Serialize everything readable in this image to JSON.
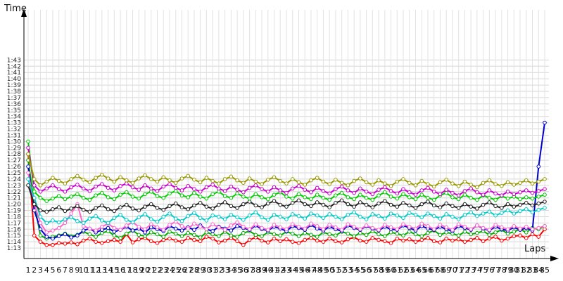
{
  "chart_data": {
    "type": "line",
    "title": "",
    "xlabel": "Laps",
    "ylabel": "Time",
    "x_ticks": [
      "1",
      "2",
      "3",
      "4",
      "5",
      "6",
      "7",
      "8",
      "9",
      "10",
      "11",
      "12",
      "13",
      "14",
      "15",
      "16",
      "17",
      "18",
      "19",
      "20",
      "21",
      "22",
      "23",
      "24",
      "25",
      "26",
      "27",
      "28",
      "29",
      "30",
      "31",
      "32",
      "33",
      "34",
      "35",
      "36",
      "37",
      "38",
      "39",
      "40",
      "41",
      "42",
      "43",
      "44",
      "45",
      "46",
      "47",
      "48",
      "49",
      "50",
      "51",
      "52",
      "53",
      "54",
      "55",
      "56",
      "57",
      "58",
      "59",
      "60",
      "61",
      "62",
      "63",
      "64",
      "65",
      "66",
      "67",
      "68",
      "69",
      "70",
      "71",
      "72",
      "73",
      "74",
      "75",
      "76",
      "77",
      "78",
      "79",
      "80",
      "81",
      "82",
      "83",
      "84",
      "85"
    ],
    "y_ticks": [
      "1:13",
      "1:14",
      "1:15",
      "1:16",
      "1:17",
      "1:18",
      "1:19",
      "1:20",
      "1:21",
      "1:22",
      "1:23",
      "1:24",
      "1:25",
      "1:26",
      "1:27",
      "1:28",
      "1:29",
      "1:30",
      "1:31",
      "1:32",
      "1:33",
      "1:34",
      "1:35",
      "1:36",
      "1:37",
      "1:38",
      "1:39",
      "1:40",
      "1:41",
      "1:42",
      "1:43"
    ],
    "y_unit": "lap time in seconds (73 = 1:13)",
    "xlim": [
      1,
      85
    ],
    "ylim": [
      72,
      111
    ],
    "grid": true,
    "legend": "none",
    "series": [
      {
        "color": "#ff0000",
        "values": [
          88,
          75,
          74,
          73.5,
          73.5,
          73.8,
          73.7,
          73.9,
          73.6,
          74.2,
          74.5,
          74.0,
          73.8,
          74.1,
          74.3,
          74.0,
          75.2,
          73.9,
          74.4,
          74.6,
          74.1,
          73.8,
          74.3,
          74.5,
          74.2,
          74.0,
          74.6,
          74.3,
          74.1,
          74.8,
          74.5,
          73.9,
          74.2,
          74.6,
          74.1,
          73.5,
          74.3,
          74.7,
          74.2,
          73.9,
          74.5,
          74.1,
          74.4,
          74.0,
          73.8,
          74.3,
          74.6,
          74.2,
          74.0,
          74.5,
          74.1,
          73.9,
          74.4,
          74.7,
          74.2,
          74.0,
          74.6,
          74.3,
          74.1,
          73.8,
          74.5,
          74.2,
          74.4,
          74.0,
          74.3,
          74.6,
          74.1,
          73.9,
          74.5,
          74.2,
          74.4,
          74.0,
          74.3,
          74.6,
          74.1,
          74.5,
          74.8,
          74.2,
          74.5,
          74.9,
          75.0,
          74.6,
          75.2,
          74.8,
          76.0
        ]
      },
      {
        "color": "#00aa00",
        "values": [
          87,
          80,
          75,
          74.5,
          74.8,
          75.0,
          75.3,
          74.9,
          75.1,
          75.6,
          75.2,
          74.8,
          75.4,
          75.7,
          75.0,
          74.6,
          75.3,
          75.8,
          75.1,
          74.9,
          75.5,
          75.2,
          74.8,
          75.6,
          75.3,
          74.9,
          75.4,
          75.1,
          74.7,
          75.5,
          75.2,
          74.9,
          75.6,
          75.0,
          74.8,
          75.4,
          75.7,
          75.1,
          74.9,
          75.5,
          75.2,
          75.0,
          75.6,
          75.3,
          74.9,
          75.4,
          75.1,
          74.8,
          75.5,
          75.2,
          75.0,
          75.6,
          75.3,
          74.9,
          75.4,
          75.1,
          75.7,
          75.2,
          74.9,
          75.5,
          75.3,
          75.0,
          75.6,
          75.2,
          74.9,
          75.4,
          75.8,
          75.1,
          75.5,
          75.3,
          75.0,
          75.6,
          75.2,
          75.4,
          75.7,
          75.1,
          75.5,
          75.9,
          75.3,
          75.6,
          76.0,
          75.5,
          76.2,
          76.0,
          76.5
        ]
      },
      {
        "color": "#0000cc",
        "values": [
          86,
          79,
          76,
          74.8,
          74.5,
          74.9,
          75.2,
          74.7,
          75.0,
          75.8,
          76.1,
          75.5,
          75.9,
          76.2,
          75.6,
          75.9,
          76.4,
          75.8,
          76.1,
          75.5,
          76.3,
          76.0,
          75.7,
          76.5,
          76.1,
          75.8,
          76.3,
          75.9,
          76.6,
          76.0,
          75.7,
          76.4,
          76.1,
          75.8,
          76.5,
          76.2,
          75.9,
          76.6,
          76.0,
          75.8,
          76.4,
          76.1,
          75.7,
          76.5,
          76.2,
          75.9,
          76.7,
          76.1,
          75.8,
          76.4,
          76.0,
          75.7,
          76.6,
          76.2,
          75.9,
          76.5,
          76.1,
          75.8,
          76.4,
          76.0,
          75.9,
          76.6,
          76.2,
          75.8,
          76.5,
          76.1,
          75.9,
          76.4,
          76.0,
          75.7,
          76.5,
          76.2,
          75.9,
          76.6,
          76.1,
          75.8,
          76.4,
          76.0,
          75.8,
          76.3,
          75.9,
          76.2,
          75.8,
          86.0,
          93.0
        ]
      },
      {
        "color": "#ff66cc",
        "values": [
          85,
          80,
          77,
          75.5,
          75.8,
          76.2,
          77.0,
          78.5,
          80.0,
          76.5,
          76.1,
          75.8,
          76.4,
          76.9,
          76.2,
          75.9,
          76.6,
          77.1,
          76.4,
          76.0,
          76.8,
          76.3,
          75.9,
          76.7,
          77.2,
          76.5,
          76.1,
          76.9,
          76.4,
          76.0,
          76.8,
          76.3,
          75.9,
          76.6,
          77.1,
          76.4,
          76.0,
          76.8,
          76.2,
          75.9,
          76.7,
          76.3,
          76.0,
          76.8,
          76.4,
          76.1,
          76.9,
          76.5,
          76.0,
          76.7,
          76.3,
          75.9,
          76.8,
          76.4,
          76.0,
          76.6,
          76.2,
          75.9,
          76.7,
          76.3,
          76.0,
          76.8,
          76.4,
          76.1,
          76.9,
          76.5,
          76.0,
          76.7,
          76.3,
          75.9,
          76.8,
          76.4,
          76.0,
          76.6,
          76.2,
          75.9,
          76.7,
          76.3,
          76.0,
          76.5,
          76.1,
          76.4,
          76.0,
          76.2,
          76.5
        ]
      },
      {
        "color": "#00cccc",
        "values": [
          84,
          81,
          78,
          77.0,
          77.4,
          77.1,
          77.6,
          77.9,
          77.3,
          77.0,
          77.7,
          78.1,
          77.4,
          77.0,
          77.8,
          78.3,
          77.5,
          77.1,
          77.9,
          78.4,
          77.6,
          77.2,
          78.0,
          78.5,
          77.7,
          77.3,
          78.1,
          78.6,
          77.8,
          77.4,
          78.2,
          78.0,
          77.6,
          78.3,
          77.9,
          77.5,
          78.2,
          78.7,
          77.9,
          77.5,
          78.3,
          78.0,
          77.6,
          78.4,
          78.1,
          77.7,
          78.5,
          78.2,
          77.8,
          78.4,
          78.0,
          77.6,
          78.3,
          78.7,
          78.0,
          77.6,
          78.4,
          78.1,
          77.7,
          78.5,
          78.2,
          77.8,
          78.6,
          78.3,
          77.9,
          78.5,
          78.1,
          77.7,
          78.4,
          78.0,
          77.6,
          78.3,
          78.7,
          78.1,
          78.5,
          78.8,
          78.2,
          78.6,
          79.0,
          78.5,
          78.9,
          79.2,
          78.7,
          79.1,
          79.4
        ]
      },
      {
        "color": "#222222",
        "values": [
          83,
          80,
          79,
          78.8,
          79.2,
          79.5,
          78.9,
          79.3,
          79.7,
          79.1,
          78.8,
          79.4,
          79.8,
          79.2,
          78.9,
          79.5,
          79.9,
          79.3,
          79.0,
          79.6,
          80.0,
          79.4,
          79.1,
          79.7,
          80.1,
          79.5,
          79.2,
          79.8,
          80.2,
          79.6,
          79.3,
          79.9,
          80.3,
          79.7,
          79.4,
          80.0,
          80.4,
          79.8,
          79.5,
          80.1,
          80.5,
          79.9,
          79.6,
          80.2,
          80.6,
          80.0,
          79.7,
          80.3,
          79.9,
          79.5,
          80.2,
          80.6,
          80.0,
          79.6,
          80.3,
          79.9,
          79.5,
          80.1,
          80.5,
          79.9,
          79.6,
          80.2,
          79.8,
          79.4,
          80.0,
          80.4,
          79.8,
          79.5,
          80.1,
          79.7,
          79.4,
          80.0,
          79.6,
          79.3,
          79.9,
          80.3,
          79.7,
          79.4,
          80.0,
          79.6,
          79.9,
          80.2,
          79.8,
          80.1,
          80.4
        ]
      },
      {
        "color": "#00cc00",
        "values": [
          90,
          82,
          81,
          80.5,
          80.9,
          81.3,
          80.8,
          81.2,
          81.6,
          81.0,
          80.7,
          81.4,
          81.8,
          81.1,
          80.8,
          81.5,
          81.9,
          81.2,
          80.9,
          81.6,
          82.0,
          81.3,
          81.0,
          81.7,
          82.1,
          81.4,
          81.1,
          81.8,
          81.2,
          80.9,
          81.6,
          82.0,
          81.3,
          81.0,
          81.7,
          81.2,
          80.9,
          81.6,
          81.1,
          80.8,
          81.5,
          81.9,
          81.2,
          80.9,
          81.6,
          81.1,
          80.8,
          81.5,
          81.0,
          80.7,
          81.4,
          81.8,
          81.1,
          80.8,
          81.5,
          81.0,
          80.7,
          81.4,
          81.9,
          81.2,
          80.9,
          81.6,
          81.1,
          80.8,
          81.5,
          81.0,
          80.7,
          81.4,
          81.8,
          81.1,
          80.8,
          81.5,
          81.0,
          80.7,
          81.4,
          81.0,
          80.7,
          81.3,
          80.9,
          81.2,
          80.8,
          81.1,
          80.9,
          81.2,
          81.5
        ]
      },
      {
        "color": "#cc00cc",
        "values": [
          89,
          83,
          82,
          82.5,
          83.0,
          82.4,
          82.0,
          82.7,
          83.1,
          82.5,
          82.1,
          82.8,
          83.2,
          82.6,
          82.2,
          82.9,
          83.3,
          82.7,
          82.3,
          83.0,
          82.5,
          82.1,
          82.8,
          83.2,
          82.6,
          82.2,
          82.9,
          82.4,
          82.0,
          82.7,
          83.1,
          82.5,
          82.1,
          82.8,
          82.3,
          81.9,
          82.6,
          83.0,
          82.4,
          82.0,
          82.7,
          82.2,
          81.8,
          82.5,
          82.9,
          82.3,
          81.9,
          82.6,
          82.1,
          81.7,
          82.4,
          82.8,
          82.2,
          81.8,
          82.5,
          82.0,
          81.6,
          82.3,
          82.7,
          82.1,
          81.7,
          82.4,
          81.9,
          81.5,
          82.2,
          82.6,
          82.0,
          81.6,
          82.3,
          81.8,
          81.4,
          82.1,
          82.5,
          81.9,
          81.5,
          82.2,
          81.7,
          81.4,
          82.0,
          81.6,
          81.9,
          82.2,
          81.8,
          82.1,
          82.4
        ]
      },
      {
        "color": "#999900",
        "values": [
          88,
          84,
          83,
          83.6,
          84.2,
          83.7,
          83.3,
          84.0,
          84.5,
          83.9,
          83.5,
          84.2,
          84.7,
          84.1,
          83.6,
          84.3,
          83.8,
          83.4,
          84.1,
          84.6,
          84.0,
          83.6,
          84.3,
          83.8,
          83.4,
          84.1,
          84.5,
          83.9,
          83.5,
          84.2,
          83.7,
          83.3,
          84.0,
          84.4,
          83.8,
          83.4,
          84.1,
          83.6,
          83.2,
          83.9,
          84.3,
          83.7,
          83.3,
          84.0,
          83.5,
          83.1,
          83.8,
          84.2,
          83.6,
          83.2,
          83.9,
          83.4,
          83.0,
          83.7,
          84.1,
          83.5,
          83.1,
          83.8,
          83.3,
          82.9,
          83.6,
          84.0,
          83.4,
          83.0,
          83.7,
          83.2,
          82.8,
          83.5,
          83.9,
          83.3,
          82.9,
          83.6,
          83.1,
          82.7,
          83.4,
          83.8,
          83.2,
          82.9,
          83.5,
          83.1,
          83.4,
          83.8,
          83.3,
          83.6,
          84.0
        ]
      }
    ]
  }
}
